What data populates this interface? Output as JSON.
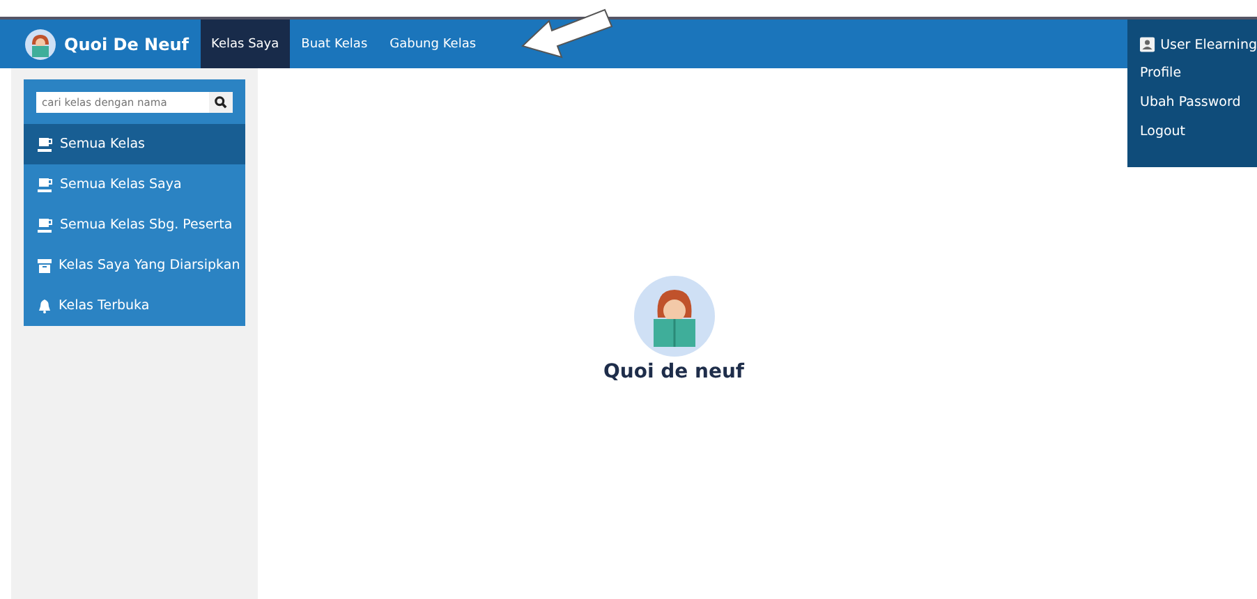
{
  "navbar": {
    "brand": "Quoi De Neuf",
    "tabs": [
      {
        "label": "Kelas Saya",
        "selected": true
      },
      {
        "label": "Buat Kelas",
        "selected": false
      },
      {
        "label": "Gabung Kelas",
        "selected": false
      }
    ]
  },
  "user_menu": {
    "name": "User Elearning",
    "items": [
      "Profile",
      "Ubah Password",
      "Logout"
    ]
  },
  "sidebar": {
    "search": {
      "placeholder": "cari kelas dengan nama"
    },
    "items": [
      {
        "label": "Semua Kelas",
        "kind": "cup",
        "selected": true
      },
      {
        "label": "Semua Kelas Saya",
        "kind": "cup",
        "selected": false
      },
      {
        "label": "Semua Kelas Sbg. Peserta",
        "kind": "cup",
        "selected": false
      },
      {
        "label": "Kelas Saya Yang Diarsipkan",
        "kind": "archive",
        "selected": false
      },
      {
        "label": "Kelas Terbuka",
        "kind": "bell",
        "selected": false
      }
    ]
  },
  "main": {
    "title": "Quoi de neuf"
  }
}
